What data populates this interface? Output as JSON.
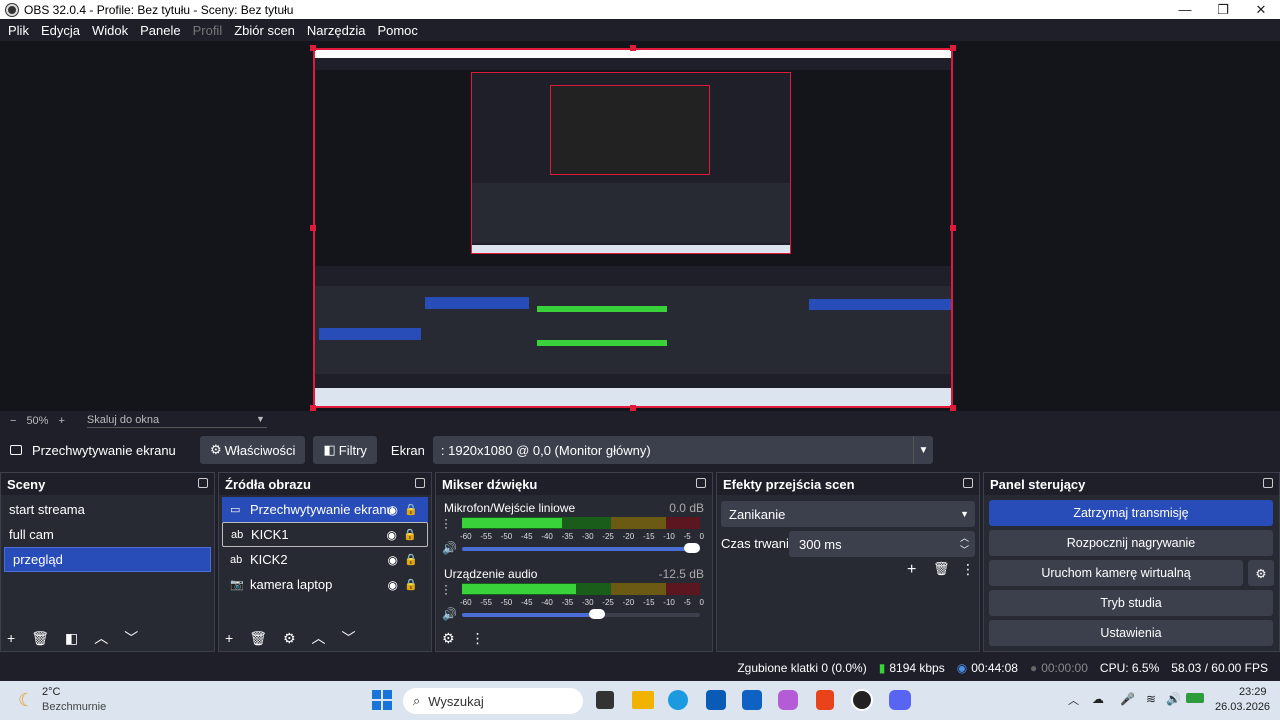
{
  "window": {
    "title": "OBS 32.0.4 - Profile: Bez tytułu - Sceny: Bez tytułu",
    "minimize": "—",
    "maximize": "❐",
    "close": "✕"
  },
  "menu": [
    "Plik",
    "Edycja",
    "Widok",
    "Panele",
    "Profil",
    "Zbiór scen",
    "Narzędzia",
    "Pomoc"
  ],
  "zoom": {
    "minus": "−",
    "value": "50%",
    "plus": "+",
    "scale_label": "Skaluj do okna"
  },
  "source_toolbar": {
    "source_name": "Przechwytywanie ekranu",
    "properties": "Właściwości",
    "filters": "Filtry",
    "screen_label": "Ekran",
    "screen_value": ": 1920x1080 @ 0,0 (Monitor główny)"
  },
  "scenes": {
    "title": "Sceny",
    "items": [
      "start streama",
      "full cam",
      "przegląd"
    ],
    "selected": 2
  },
  "sources": {
    "title": "Źródła obrazu",
    "items": [
      {
        "name": "Przechwytywanie ekranu",
        "icon": "monitor-icon"
      },
      {
        "name": "KICK1",
        "icon": "text-icon"
      },
      {
        "name": "KICK2",
        "icon": "text-icon"
      },
      {
        "name": "kamera laptop",
        "icon": "camera-icon"
      }
    ]
  },
  "mixer": {
    "title": "Mikser dźwięku",
    "channels": [
      {
        "name": "Mikrofon/Wejście liniowe",
        "db": "0.0 dB",
        "level": 0.42,
        "volume": 1.0
      },
      {
        "name": "Urządzenie audio",
        "db": "-12.5 dB",
        "level": 0.48,
        "volume": 0.6
      }
    ],
    "ticks": [
      "-60",
      "-55",
      "-50",
      "-45",
      "-40",
      "-35",
      "-30",
      "-25",
      "-20",
      "-15",
      "-10",
      "-5",
      "0"
    ]
  },
  "transitions": {
    "title": "Efekty przejścia scen",
    "effect": "Zanikanie",
    "duration_label": "Czas trwania",
    "duration": "300 ms"
  },
  "controls": {
    "title": "Panel sterujący",
    "buttons": [
      "Zatrzymaj transmisję",
      "Rozpocznij nagrywanie",
      "Uruchom kamerę wirtualną",
      "Tryb studia",
      "Ustawienia"
    ]
  },
  "status": {
    "dropped": "Zgubione klatki 0 (0.0%)",
    "bitrate": "8194 kbps",
    "stream_time": "00:44:08",
    "rec_time": "00:00:00",
    "cpu": "CPU: 6.5%",
    "fps": "58.03 / 60.00 FPS"
  },
  "taskbar": {
    "weather_temp": "2°C",
    "weather_desc": "Bezchmurnie",
    "search": "Wyszukaj",
    "time": "23:29",
    "date": "26.03.2026"
  }
}
